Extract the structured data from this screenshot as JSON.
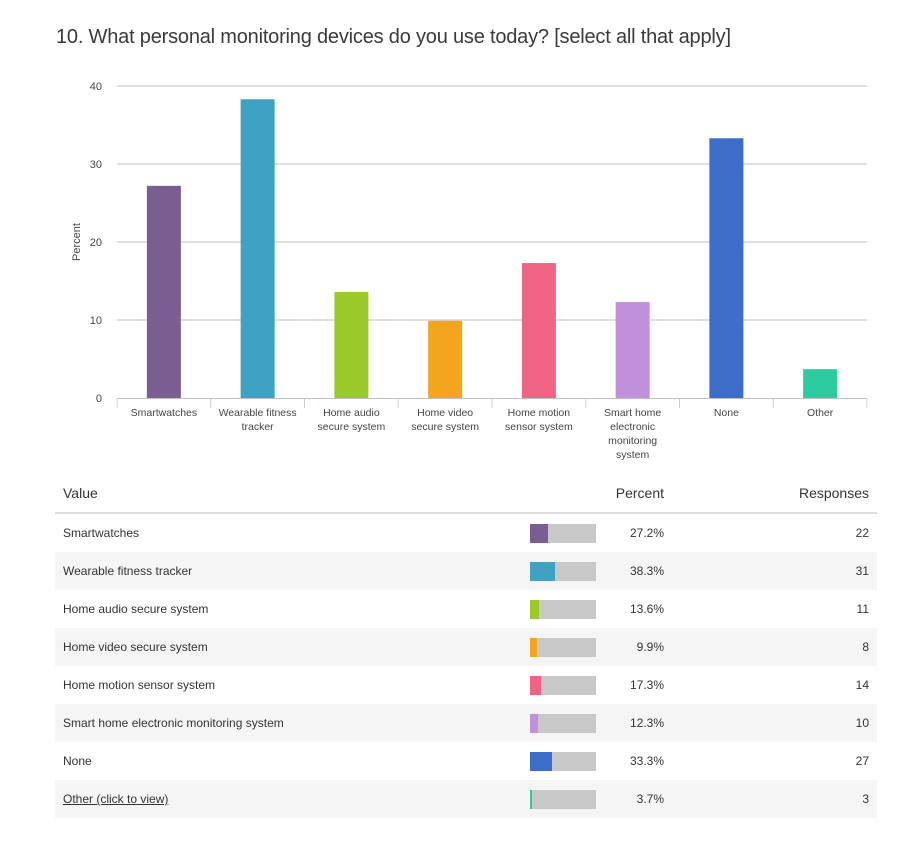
{
  "question": {
    "title": "10. What personal monitoring devices do you use today? [select all that apply]"
  },
  "chart_data": {
    "type": "bar",
    "title": "10. What personal monitoring devices do you use today? [select all that apply]",
    "xlabel": "",
    "ylabel": "Percent",
    "ylim": [
      0,
      40
    ],
    "yticks": [
      0,
      10,
      20,
      30,
      40
    ],
    "grid": true,
    "legend": "none",
    "categories": [
      [
        "Smartwatches"
      ],
      [
        "Wearable fitness",
        "tracker"
      ],
      [
        "Home audio",
        "secure system"
      ],
      [
        "Home video",
        "secure system"
      ],
      [
        "Home motion",
        "sensor system"
      ],
      [
        "Smart home",
        "electronic",
        "monitoring",
        "system"
      ],
      [
        "None"
      ],
      [
        "Other"
      ]
    ],
    "values": [
      27.2,
      38.3,
      13.6,
      9.9,
      17.3,
      12.3,
      33.3,
      3.7
    ],
    "colors": [
      "#7b5e91",
      "#3fa2c2",
      "#9aca2a",
      "#f3a51d",
      "#ef6384",
      "#c190db",
      "#3e6cc9",
      "#2ecba1"
    ]
  },
  "table": {
    "headers": {
      "value": "Value",
      "percent": "Percent",
      "responses": "Responses"
    },
    "bar_track_color": "#c8c8c8",
    "rows": [
      {
        "label": "Smartwatches",
        "percent_value": 27.2,
        "percent": "27.2%",
        "responses": "22",
        "color": "#7b5e91"
      },
      {
        "label": "Wearable fitness tracker",
        "percent_value": 38.3,
        "percent": "38.3%",
        "responses": "31",
        "color": "#3fa2c2"
      },
      {
        "label": "Home audio secure system",
        "percent_value": 13.6,
        "percent": "13.6%",
        "responses": "11",
        "color": "#9aca2a"
      },
      {
        "label": "Home video secure system",
        "percent_value": 9.9,
        "percent": "9.9%",
        "responses": "8",
        "color": "#f3a51d"
      },
      {
        "label": "Home motion sensor system",
        "percent_value": 17.3,
        "percent": "17.3%",
        "responses": "14",
        "color": "#ef6384"
      },
      {
        "label": "Smart home electronic monitoring system",
        "percent_value": 12.3,
        "percent": "12.3%",
        "responses": "10",
        "color": "#c190db"
      },
      {
        "label": "None",
        "percent_value": 33.3,
        "percent": "33.3%",
        "responses": "27",
        "color": "#3e6cc9"
      },
      {
        "label": "Other (click to view)",
        "percent_value": 3.7,
        "percent": "3.7%",
        "responses": "3",
        "color": "#2ecba1",
        "is_link": true
      }
    ]
  }
}
